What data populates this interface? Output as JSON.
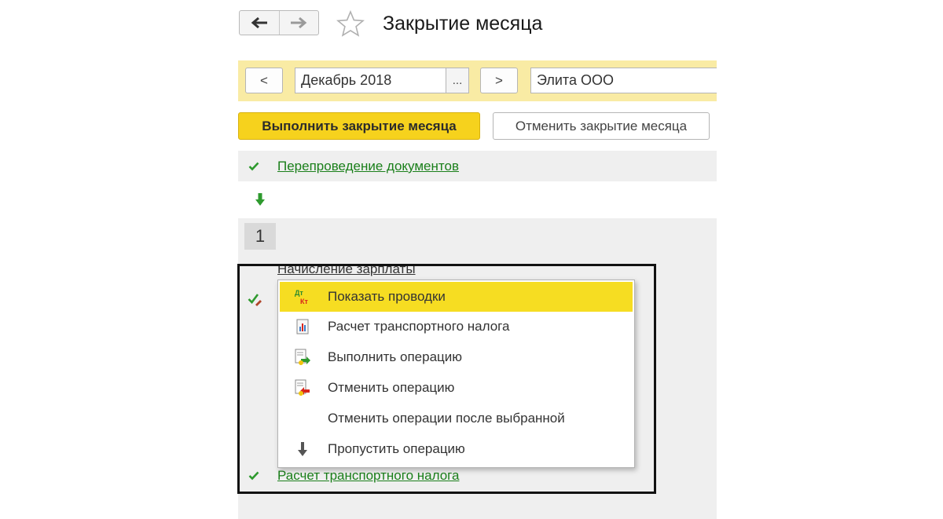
{
  "header": {
    "title": "Закрытие месяца",
    "back_icon": "arrow-left-icon",
    "forward_icon": "arrow-right-icon",
    "favorite_icon": "star-icon"
  },
  "period_bar": {
    "prev_label": "<",
    "period_value": "Декабрь 2018",
    "select_label": "...",
    "next_label": ">",
    "organization_value": "Элита ООО"
  },
  "actions": {
    "execute_label": "Выполнить закрытие месяца",
    "cancel_label": "Отменить закрытие месяца"
  },
  "steps": {
    "reposting_label": "Перепроведение документов",
    "stage_number": "1",
    "payroll_label": "Начисление зарплаты",
    "transport_tax_label": "Расчет транспортного налога"
  },
  "context_menu": {
    "items": [
      {
        "label": "Показать проводки",
        "icon": "dt-kt-icon"
      },
      {
        "label": "Расчет транспортного налога",
        "icon": "report-icon"
      },
      {
        "label": "Выполнить операцию",
        "icon": "execute-operation-icon"
      },
      {
        "label": "Отменить операцию",
        "icon": "cancel-operation-icon"
      },
      {
        "label": "Отменить операции после выбранной",
        "icon": ""
      },
      {
        "label": "Пропустить операцию",
        "icon": "arrow-down-icon"
      }
    ]
  },
  "colors": {
    "accent_yellow": "#f6d21d",
    "period_bar": "#f9eba4",
    "link_green": "#1a7f1a",
    "highlight_frame": "#111111"
  }
}
